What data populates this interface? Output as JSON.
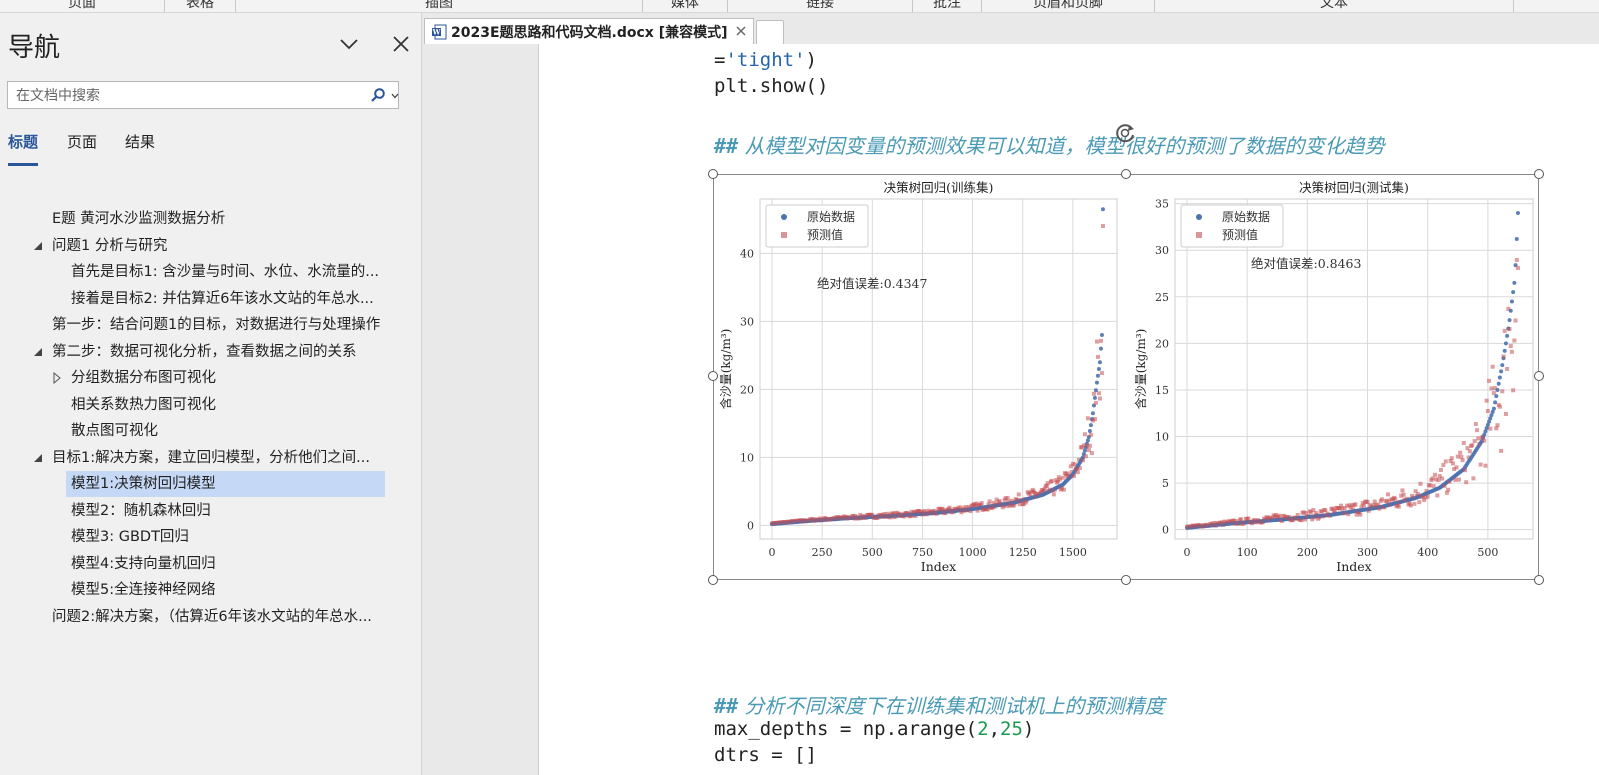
{
  "ribbon": {
    "groups": [
      "页面",
      "表格",
      "插图",
      "媒体",
      "链接",
      "批注",
      "页眉和页脚",
      "文本"
    ]
  },
  "nav": {
    "title": "导航",
    "search_placeholder": "在文档中搜索",
    "tabs": [
      "标题",
      "页面",
      "结果"
    ],
    "items": [
      {
        "label": "E题 黄河水沙监测数据分析",
        "level": 1,
        "toggle": "none"
      },
      {
        "label": "问题1 分析与研究",
        "level": 1,
        "toggle": "expanded"
      },
      {
        "label": "首先是目标1: 含沙量与时间、水位、水流量的...",
        "level": 2,
        "toggle": "none"
      },
      {
        "label": "接着是目标2: 并估算近6年该水文站的年总水...",
        "level": 2,
        "toggle": "none"
      },
      {
        "label": "第一步：结合问题1的目标，对数据进行与处理操作",
        "level": 1,
        "toggle": "none"
      },
      {
        "label": "第二步：数据可视化分析，查看数据之间的关系",
        "level": 1,
        "toggle": "expanded"
      },
      {
        "label": "分组数据分布图可视化",
        "level": 2,
        "toggle": "collapsed"
      },
      {
        "label": "相关系数热力图可视化",
        "level": 2,
        "toggle": "none"
      },
      {
        "label": "散点图可视化",
        "level": 2,
        "toggle": "none"
      },
      {
        "label": "目标1:解决方案，建立回归模型，分析他们之间...",
        "level": 1,
        "toggle": "expanded"
      },
      {
        "label": "模型1:决策树回归模型",
        "level": 2,
        "toggle": "none",
        "selected": true
      },
      {
        "label": "模型2：随机森林回归",
        "level": 2,
        "toggle": "none"
      },
      {
        "label": "模型3: GBDT回归",
        "level": 2,
        "toggle": "none"
      },
      {
        "label": "模型4:支持向量机回归",
        "level": 2,
        "toggle": "none"
      },
      {
        "label": "模型5:全连接神经网络",
        "level": 2,
        "toggle": "none"
      },
      {
        "label": "问题2:解决方案，（估算近6年该水文站的年总水...",
        "level": 1,
        "toggle": "none"
      }
    ]
  },
  "doc": {
    "tab_label": "2023E题思路和代码文档.docx [兼容模式]",
    "code_line1_prefix": "=",
    "code_line1_str": "'tight'",
    "code_line1_suffix": ")",
    "code_line2": "plt.show()",
    "comment1_hash": "##",
    "comment1_text": " 从模型对因变量的预测效果可以知道，模型很好的预测了数据的变化趋势",
    "comment2_hash": "##",
    "comment2_text": " 分析不同深度下在训练集和测试机上的预测精度",
    "code_line3_prefix": "max_depths = np.arange(",
    "code_line3_n1": "2",
    "code_line3_sep": ",",
    "code_line3_n2": "25",
    "code_line3_suffix": ")",
    "code_line4": "dtrs = []"
  },
  "colors": {
    "accent": "#2b579a",
    "selection": "#c5d8f5",
    "original_series": "#4c72b0",
    "predicted_series": "#c44e52",
    "comment": "#4a9ab5"
  },
  "chart_data": [
    {
      "type": "scatter",
      "title": "决策树回归(训练集)",
      "xlabel": "Index",
      "ylabel": "含沙量(kg/m³)",
      "xlim": [
        -60,
        1720
      ],
      "ylim": [
        -2,
        48
      ],
      "xticks": [
        0,
        250,
        500,
        750,
        1000,
        1250,
        1500
      ],
      "yticks": [
        0,
        10,
        20,
        30,
        40
      ],
      "grid": true,
      "legend_position": "top-left",
      "annotation": "绝对值误差:0.4347",
      "n_points": 1650,
      "series": [
        {
          "name": "原始数据",
          "marker": "circle",
          "x": [
            0,
            200,
            400,
            600,
            800,
            1000,
            1200,
            1350,
            1450,
            1500,
            1550,
            1580,
            1600,
            1620,
            1635,
            1645,
            1650
          ],
          "values": [
            0.2,
            0.7,
            1.1,
            1.4,
            1.8,
            2.4,
            3.3,
            4.5,
            6.0,
            7.5,
            10.0,
            13.0,
            16.5,
            21.0,
            24.0,
            28.0,
            46.5
          ]
        },
        {
          "name": "预测值",
          "marker": "square",
          "x": [
            0,
            200,
            400,
            600,
            800,
            1000,
            1200,
            1350,
            1450,
            1500,
            1550,
            1580,
            1600,
            1620,
            1635,
            1645,
            1650
          ],
          "values": [
            0.3,
            0.8,
            1.2,
            1.5,
            1.9,
            2.6,
            3.5,
            4.8,
            6.2,
            7.8,
            10.3,
            14.0,
            14.0,
            22.8,
            22.8,
            28.5,
            37.5
          ]
        }
      ]
    },
    {
      "type": "scatter",
      "title": "决策树回归(测试集)",
      "xlabel": "Index",
      "ylabel": "含沙量(kg/m³)",
      "xlim": [
        -20,
        575
      ],
      "ylim": [
        -1,
        35.5
      ],
      "xticks": [
        0,
        100,
        200,
        300,
        400,
        500
      ],
      "yticks": [
        0,
        5,
        10,
        15,
        20,
        25,
        30,
        35
      ],
      "grid": true,
      "legend_position": "top-left",
      "annotation": "绝对值误差:0.8463",
      "n_points": 550,
      "series": [
        {
          "name": "原始数据",
          "marker": "circle",
          "x": [
            0,
            80,
            160,
            240,
            320,
            380,
            420,
            460,
            490,
            510,
            525,
            535,
            545,
            550
          ],
          "values": [
            0.2,
            0.7,
            1.1,
            1.6,
            2.4,
            3.4,
            4.5,
            6.5,
            9.5,
            13.0,
            18.0,
            22.0,
            27.0,
            34.0
          ]
        },
        {
          "name": "预测值",
          "marker": "square",
          "x": [
            0,
            80,
            160,
            240,
            320,
            380,
            420,
            460,
            490,
            510,
            525,
            535,
            545,
            550
          ],
          "values": [
            0.3,
            0.8,
            1.3,
            1.8,
            2.7,
            3.8,
            5.0,
            7.2,
            9.0,
            14.0,
            14.0,
            22.8,
            22.8,
            28.0
          ]
        }
      ]
    }
  ]
}
